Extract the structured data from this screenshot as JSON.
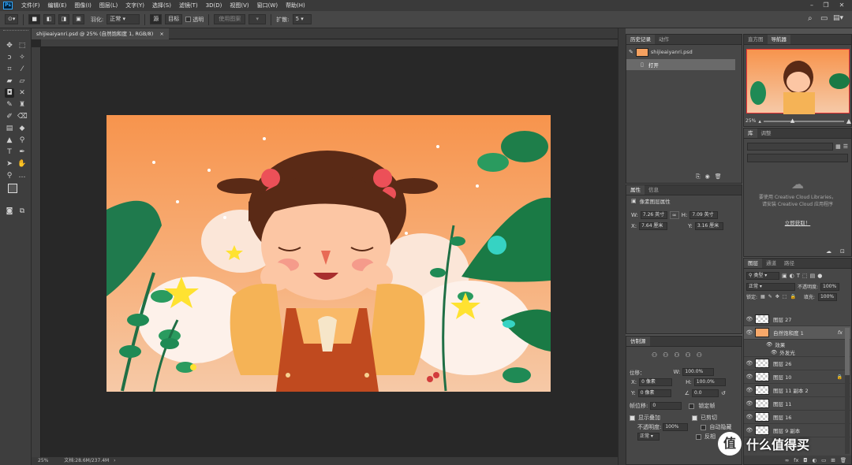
{
  "menu": [
    "文件(F)",
    "编辑(E)",
    "图像(I)",
    "图层(L)",
    "文字(Y)",
    "选择(S)",
    "滤镜(T)",
    "3D(D)",
    "视图(V)",
    "窗口(W)",
    "帮助(H)"
  ],
  "options": {
    "feather_label": "羽化:",
    "feather_value": "正常",
    "source_btn": "源",
    "target_btn": "目标",
    "transparent_label": "透明",
    "use_pattern_btn": "使用图案",
    "diffusion_label": "扩散:",
    "diffusion_value": "5"
  },
  "document": {
    "tab_title": "shijieaiyanri.psd @ 25% (自然饱和度 1, RGB/8)",
    "tab_close": "×",
    "zoom": "25%",
    "doc_info": "文档:28.6M/237.4M"
  },
  "history": {
    "tabs": [
      "历史记录",
      "动作"
    ],
    "snapshot": "shijieaiyanri.psd",
    "item_open": "打开"
  },
  "navigator": {
    "tabs": [
      "直方图",
      "导航器"
    ],
    "zoom": "25%"
  },
  "library": {
    "tabs": [
      "库",
      "调整"
    ],
    "line1": "要使用 Creative Cloud Libraries，",
    "line2": "请安装 Creative Cloud 应用程序",
    "link": "立即获取！"
  },
  "properties": {
    "tabs": [
      "属性",
      "信息"
    ],
    "title": "像素图层属性",
    "w_label": "W:",
    "w_value": "7.26 英寸",
    "h_label": "H:",
    "h_value": "7.09 英寸",
    "x_label": "X:",
    "x_value": "7.64 厘米",
    "y_label": "Y:",
    "y_value": "3.16 厘米"
  },
  "clone_source": {
    "tab": "仿制源",
    "offset_label": "位移：",
    "x_label": "X:",
    "x_value": "0 像素",
    "y_label": "Y:",
    "y_value": "0 像素",
    "w_label": "W:",
    "w_value": "100.0%",
    "h_label": "H:",
    "h_value": "100.0%",
    "angle_value": "0.0",
    "frame_offset_label": "帧位移:",
    "frame_offset_value": "0",
    "lock_frame": "锁定帧",
    "show_overlay": "显示叠加",
    "opacity_label": "不透明度:",
    "opacity_value": "100%",
    "clipped": "已剪切",
    "auto_hide": "自动隐藏",
    "invert": "反相",
    "blend": "正常"
  },
  "layers": {
    "tabs": [
      "图层",
      "通道",
      "路径"
    ],
    "filter": "类型",
    "blend_mode": "正常",
    "opacity_label": "不透明度:",
    "opacity_value": "100%",
    "lock_label": "锁定:",
    "fill_label": "填充:",
    "fill_value": "100%",
    "items": [
      {
        "name": "图层 27"
      },
      {
        "name": "自然饱和度 1",
        "fx": "fx"
      },
      {
        "name": "效果"
      },
      {
        "name": "外发光"
      },
      {
        "name": "图层 26"
      },
      {
        "name": "图层 10"
      },
      {
        "name": "图层 11 副本 2"
      },
      {
        "name": "图层 11"
      },
      {
        "name": "图层 16"
      },
      {
        "name": "图层 9 副本"
      }
    ]
  },
  "watermark": {
    "icon": "值",
    "text": "什么值得买"
  },
  "colors": {
    "accent_blue": "#31a8ff",
    "selected_layer": "#5a5a5a"
  }
}
